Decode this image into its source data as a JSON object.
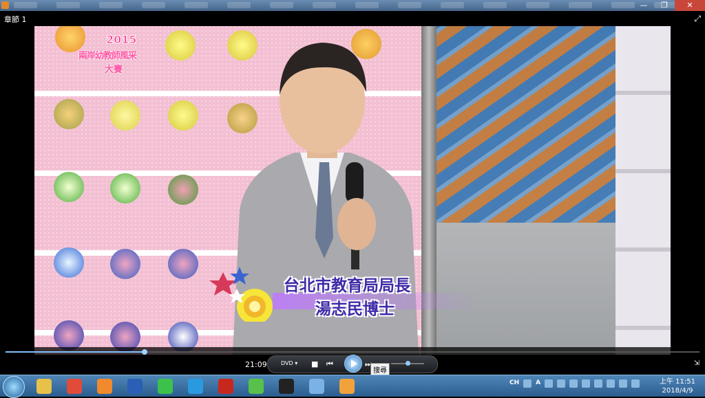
{
  "window": {
    "chapter_label": "章節 1",
    "minimize_icon": "minimize-icon",
    "maximize_icon": "maximize-icon",
    "close_icon": "close-icon",
    "min_glyph": "—",
    "max_glyph": "❐",
    "close_glyph": "✕"
  },
  "video": {
    "logo_year": "2015",
    "logo_name": "兩岸幼教師風采",
    "logo_sub": "大賽",
    "caption_line1": "台北市教育局局長",
    "caption_line2": "湯志民博士"
  },
  "player": {
    "time": "21:09",
    "source_label": "DVD",
    "progress_fraction": 0.2,
    "volume_fraction": 0.5,
    "tooltip": "搜尋",
    "accent": "#3a84c9"
  },
  "taskbar": {
    "pinned": [
      {
        "name": "file-explorer-icon",
        "color": "#e8c14a"
      },
      {
        "name": "chrome-icon",
        "color": "#e04b3a"
      },
      {
        "name": "media-player-icon",
        "color": "#f08a2c"
      },
      {
        "name": "word-icon",
        "color": "#2b5fb5"
      },
      {
        "name": "line-icon",
        "color": "#3cc24a"
      },
      {
        "name": "internet-explorer-icon",
        "color": "#2a9ae0"
      },
      {
        "name": "acrobat-icon",
        "color": "#c8271e"
      },
      {
        "name": "wechat-icon",
        "color": "#58c14a"
      },
      {
        "name": "qq-icon",
        "color": "#222222"
      },
      {
        "name": "photos-icon",
        "color": "#7bb2e6"
      },
      {
        "name": "paint-icon",
        "color": "#f2a23a"
      }
    ],
    "tray_ime": "CH",
    "tray_font": "A",
    "clock_time": "上午 11:51",
    "clock_date": "2018/4/9"
  }
}
